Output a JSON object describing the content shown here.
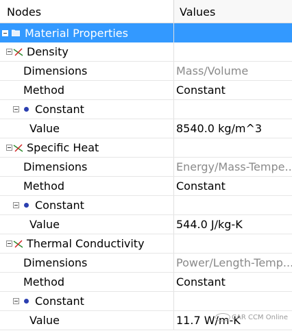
{
  "columns": {
    "nodes": "Nodes",
    "values": "Values"
  },
  "tree": {
    "root_label": "Material Properties",
    "density": {
      "label": "Density",
      "dimensions_label": "Dimensions",
      "dimensions_value": "Mass/Volume",
      "method_label": "Method",
      "method_value": "Constant",
      "constant_label": "Constant",
      "value_label": "Value",
      "value_value": "8540.0 kg/m^3"
    },
    "specific_heat": {
      "label": "Specific Heat",
      "dimensions_label": "Dimensions",
      "dimensions_value": "Energy/Mass-Tempe...",
      "method_label": "Method",
      "method_value": "Constant",
      "constant_label": "Constant",
      "value_label": "Value",
      "value_value": "544.0 J/kg-K"
    },
    "thermal_conductivity": {
      "label": "Thermal Conductivity",
      "dimensions_label": "Dimensions",
      "dimensions_value": "Power/Length-Temp...",
      "method_label": "Method",
      "method_value": "Constant",
      "constant_label": "Constant",
      "value_label": "Value",
      "value_value": "11.7 W/m-K"
    }
  },
  "watermark": {
    "text": "CAR CCM Online"
  },
  "colors": {
    "selection": "#3399ff",
    "dim_text": "#8a8a8a",
    "constant_dot": "#2b3fb0"
  },
  "icons": {
    "expander": "minus-expander-icon",
    "root": "folder-icon",
    "property": "property-node-icon",
    "method": "dot-icon"
  }
}
